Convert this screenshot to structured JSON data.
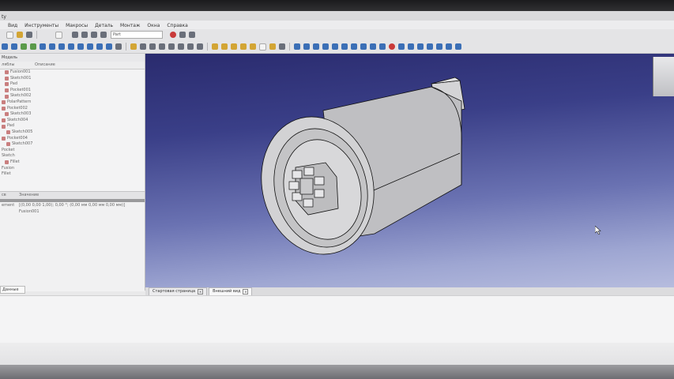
{
  "window": {
    "title_fragment": "ty"
  },
  "menu": {
    "items": [
      "Вид",
      "Инструменты",
      "Макросы",
      "Деталь",
      "Монтаж",
      "Окна",
      "Справка"
    ]
  },
  "toolbar": {
    "workbench_combo": "Part"
  },
  "tree": {
    "header": "Модель",
    "columns": {
      "labels": "ляблы",
      "description": "Описание"
    },
    "items": [
      "Fusion001",
      "Sketch001",
      "Pad",
      "Pocket001",
      "Sketch002",
      "PolarPattern",
      "Pocket002",
      "Sketch003",
      "Sketch004",
      "Pad",
      "Sketch005",
      "Pocket004",
      "Sketch007",
      "Pocket",
      "Sketch",
      "Fillet",
      "Fusion",
      "Fillet"
    ]
  },
  "properties": {
    "columns": {
      "property": "св",
      "value": "Значение"
    },
    "rows": [
      {
        "name": "ement",
        "value": "[(0,00 0,00 1,00); 0,00 °; (0,00 мм  0,00 мм  0,00 мм)]"
      },
      {
        "name": "",
        "value": "Fusion001"
      }
    ]
  },
  "left_panel": {
    "tab": "Данные"
  },
  "doc_tabs": [
    {
      "label": "Стартовая страница",
      "active": false
    },
    {
      "label": "Внешний вид",
      "active": true
    }
  ],
  "colors": {
    "view_top": "#2a2b6e",
    "view_bottom": "#b6bcde",
    "model_face": "#c9c9cb",
    "model_edge": "#111111"
  },
  "icons": [
    "new-icon",
    "open-icon",
    "save-icon",
    "undo-icon",
    "redo-icon",
    "refresh-icon",
    "macro-record-icon",
    "view-fit-icon",
    "view-iso-icon",
    "view-front-icon",
    "view-top-icon",
    "view-right-icon",
    "part-box-icon",
    "part-cylinder-icon",
    "part-sphere-icon",
    "part-cone-icon",
    "part-torus-icon",
    "boolean-icon",
    "extrude-icon",
    "revolve-icon",
    "navigation-cube-icon"
  ]
}
